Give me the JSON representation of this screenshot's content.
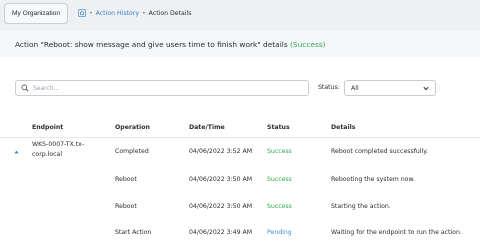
{
  "topbar": {
    "org_button": "My Organization",
    "breadcrumb": {
      "link": "Action History",
      "separator": "•",
      "current": "Action Details"
    }
  },
  "header": {
    "title": "Action \"Reboot: show message and give users time to finish work\" details",
    "status": "(Success)"
  },
  "filters": {
    "search_placeholder": "Search...",
    "status_label": "Status:",
    "status_value": "All"
  },
  "table": {
    "columns": [
      "Endpoint",
      "Operation",
      "Date/Time",
      "Status",
      "Details"
    ],
    "endpoint": [
      "WKS-0007-TX.tx-",
      "corp.local"
    ],
    "rows": [
      {
        "operation": "Completed",
        "datetime": "04/06/2022 3:52 AM",
        "status": "Success",
        "details": "Reboot completed successfully."
      },
      {
        "operation": "Reboot",
        "datetime": "04/06/2022 3:50 AM",
        "status": "Success",
        "details": "Rebooting the system now."
      },
      {
        "operation": "Reboot",
        "datetime": "04/06/2022 3:50 AM",
        "status": "Success",
        "details": "Starting the action."
      },
      {
        "operation": "Start Action",
        "datetime": "04/06/2022 3:49 AM",
        "status": "Pending",
        "details": "Waiting for the endpoint to run the action."
      }
    ]
  },
  "colors": {
    "success": "#2fa84f",
    "pending": "#3b8fd6",
    "link": "#3b82c4"
  }
}
